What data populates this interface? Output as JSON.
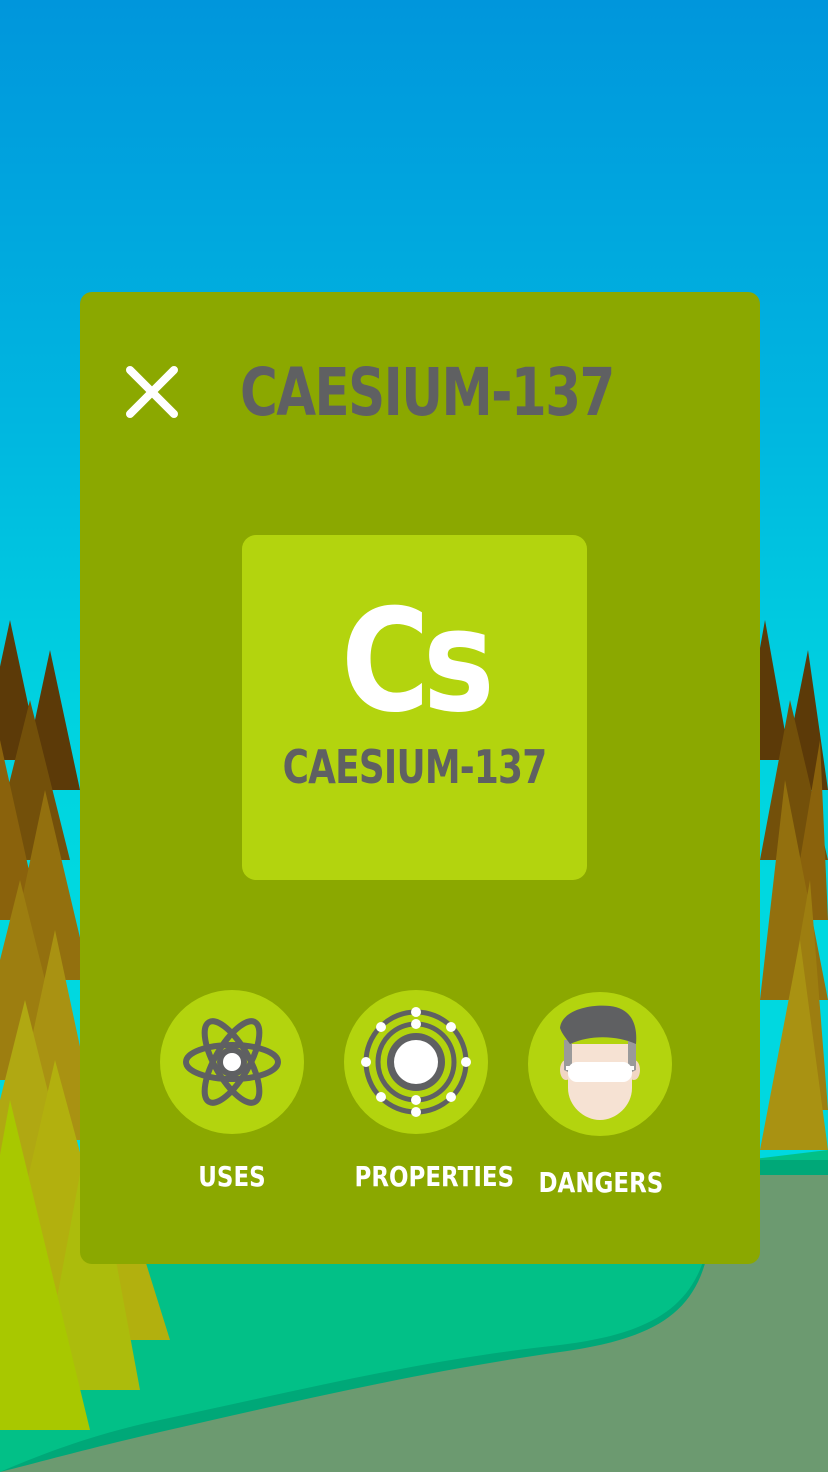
{
  "element": {
    "name": "CAESIUM-137",
    "symbol": "Cs"
  },
  "buttons": {
    "uses": "USES",
    "properties": "PROPERTIES",
    "dangers": "DANGERS"
  },
  "icons": {
    "close": "close-icon",
    "uses": "atom-icon",
    "properties": "electron-shell-icon",
    "dangers": "scientist-goggles-icon"
  },
  "colors": {
    "panel": "#8ba800",
    "tile": "#b3d40e",
    "text_dark": "#5f6062",
    "text_light": "#ffffff"
  }
}
